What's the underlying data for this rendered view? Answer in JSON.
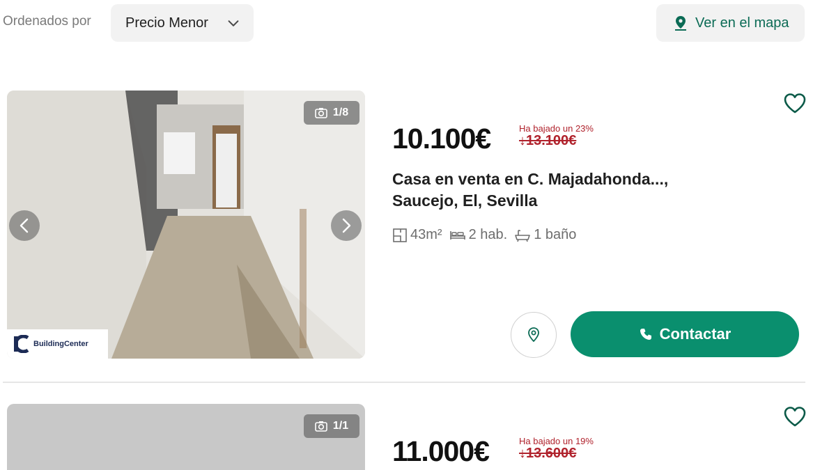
{
  "toolbar": {
    "sort_label": "Ordenados por",
    "sort_value": "Precio Menor",
    "map_button": "Ver en el mapa"
  },
  "colors": {
    "accent": "#0a8f6e",
    "price_drop": "#b0222c",
    "chip_bg": "#f2f2f2"
  },
  "listings": [
    {
      "photo_counter": "1/8",
      "logo_text": "BuildingCenter",
      "price": "10.100€",
      "drop_message": "Ha bajado un 23%",
      "old_price": "↓13.100€",
      "title_line1": "Casa en venta en C. Majadahonda...,",
      "title_line2": "Saucejo, El, Sevilla",
      "area": "43m²",
      "rooms": "2 hab.",
      "baths": "1 baño",
      "contact_label": "Contactar"
    },
    {
      "photo_counter": "1/1",
      "price": "11.000€",
      "drop_message": "Ha bajado un 19%",
      "old_price": "↓13.600€"
    }
  ]
}
